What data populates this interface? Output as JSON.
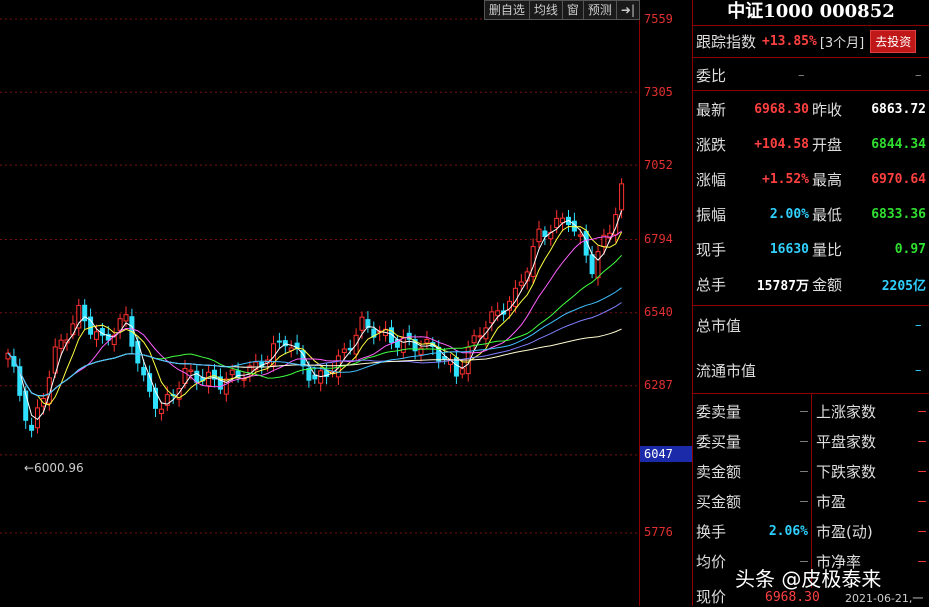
{
  "toolbar": {
    "items": [
      "删自选",
      "均线",
      "窗",
      "预测",
      "➜|"
    ]
  },
  "yaxis": {
    "ticks": [
      "7559",
      "7305",
      "7052",
      "6794",
      "6540",
      "6287",
      "5776"
    ],
    "current": "6047"
  },
  "chart_annotation": "←6000.96",
  "panel": {
    "title": "中证1000 000852",
    "track_label": "跟踪指数",
    "track_value": "+13.85%",
    "track_period": "[3个月]",
    "invest_button": "去投资",
    "weibi_label": "委比",
    "weibi_v1": "–",
    "weibi_v2": "–",
    "rows": [
      {
        "l1": "最新",
        "v1": "6968.30",
        "c1": "red",
        "l2": "昨收",
        "v2": "6863.72",
        "c2": "white"
      },
      {
        "l1": "涨跌",
        "v1": "+104.58",
        "c1": "red",
        "l2": "开盘",
        "v2": "6844.34",
        "c2": "green"
      },
      {
        "l1": "涨幅",
        "v1": "+1.52%",
        "c1": "red",
        "l2": "最高",
        "v2": "6970.64",
        "c2": "red"
      },
      {
        "l1": "振幅",
        "v1": "2.00%",
        "c1": "cyan",
        "l2": "最低",
        "v2": "6833.36",
        "c2": "green"
      },
      {
        "l1": "现手",
        "v1": "16630",
        "c1": "cyan",
        "l2": "量比",
        "v2": "0.97",
        "c2": "green"
      },
      {
        "l1": "总手",
        "v1": "15787万",
        "c1": "white",
        "l2": "金额",
        "v2": "2205亿",
        "c2": "cyan"
      }
    ],
    "total_mv_label": "总市值",
    "float_mv_label": "流通市值",
    "left_rows": [
      {
        "l": "委卖量",
        "v": "–"
      },
      {
        "l": "委买量",
        "v": "–"
      },
      {
        "l": "卖金额",
        "v": "–"
      },
      {
        "l": "买金额",
        "v": "–"
      },
      {
        "l": "换手",
        "v": "2.06%"
      },
      {
        "l": "均价",
        "v": "–"
      }
    ],
    "right_rows": [
      {
        "l": "上涨家数",
        "v": "–"
      },
      {
        "l": "平盘家数",
        "v": "–"
      },
      {
        "l": "下跌家数",
        "v": "–"
      },
      {
        "l": "市盈",
        "v": "–"
      },
      {
        "l": "市盈(动)",
        "v": "–"
      },
      {
        "l": "市净率",
        "v": "–"
      }
    ],
    "bottom_label": "现价",
    "bottom_price": "6968.30",
    "bottom_date": "2021-06-21,一"
  },
  "watermark": "头条 @皮极泰来",
  "colors": {
    "up": "#ff3030",
    "down": "#30e0ff",
    "ma1": "#ffffff",
    "ma2": "#ffff40",
    "ma3": "#ff60ff",
    "ma4": "#40ff40",
    "ma5": "#8080ff",
    "ma6": "#fffbd0",
    "ma7": "#40c0ff"
  }
}
